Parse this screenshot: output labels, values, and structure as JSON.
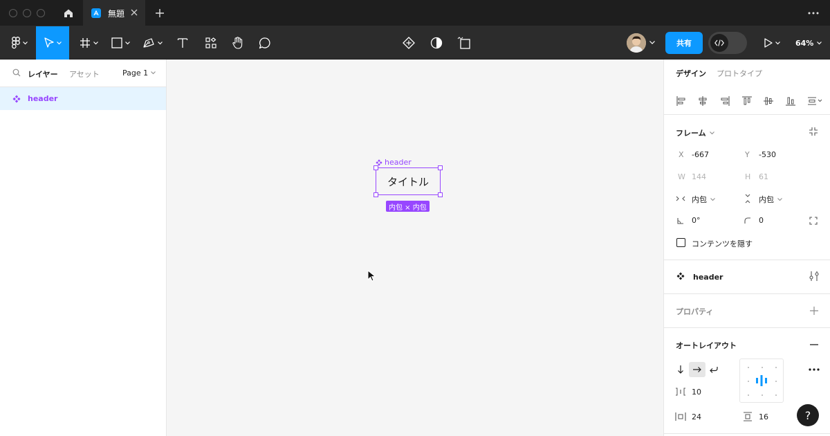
{
  "titlebar": {
    "tab_title": "無題"
  },
  "toolbar": {
    "share_label": "共有",
    "zoom_label": "64%"
  },
  "left_panel": {
    "tab_layers": "レイヤー",
    "tab_assets": "アセット",
    "page_label": "Page 1",
    "layers": [
      {
        "label": "header",
        "selected": true
      }
    ]
  },
  "canvas": {
    "frame_label": "header",
    "frame_text": "タイトル",
    "size_badge": "内包 × 内包"
  },
  "right_panel": {
    "tab_design": "デザイン",
    "tab_prototype": "プロトタイプ",
    "frame_section": {
      "title": "フレーム",
      "x_label": "X",
      "x_value": "-667",
      "y_label": "Y",
      "y_value": "-530",
      "w_label": "W",
      "w_value": "144",
      "h_label": "H",
      "h_value": "61",
      "width_mode": "内包",
      "height_mode": "内包",
      "rotation": "0°",
      "radius": "0",
      "clip_label": "コンテンツを隠す"
    },
    "component_section": {
      "name": "header"
    },
    "properties_section": {
      "title": "プロパティ"
    },
    "autolayout_section": {
      "title": "オートレイアウト",
      "gap": "10",
      "horizontal_padding": "24",
      "vertical_padding": "16"
    }
  },
  "help_label": "?",
  "colors": {
    "accent": "#0d99ff",
    "component": "#9747ff",
    "dark_chrome": "#2c2c2c"
  }
}
